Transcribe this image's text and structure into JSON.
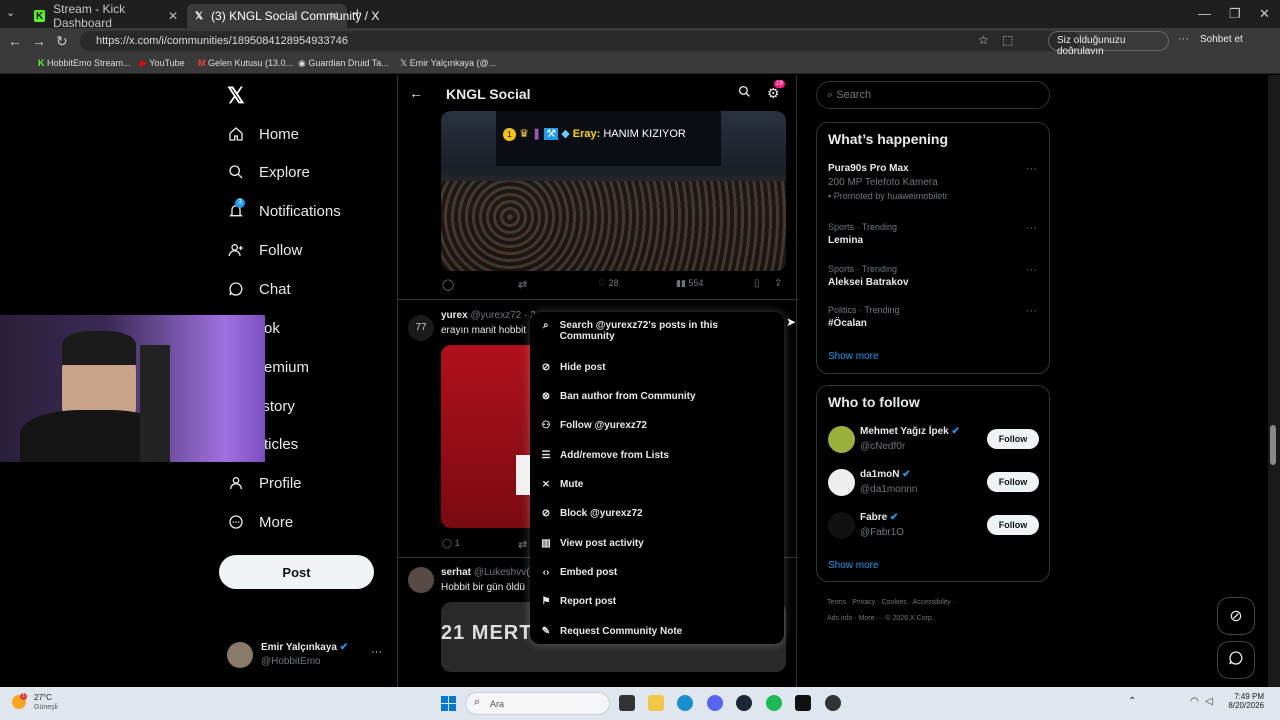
{
  "browser": {
    "tabs": [
      {
        "title": "Stream - Kick Dashboard",
        "active": false
      },
      {
        "title": "(3) KNGL Social Community / X",
        "active": true
      }
    ],
    "url": "https://x.com/i/communities/1895084128954933746",
    "verify_label": "Siz olduğunuzu doğrulayın",
    "chat_label": "Sohbet et",
    "bookmarks": [
      "HobbitEmo Stream...",
      "YouTube",
      "Gelen Kutusu (13.0...",
      "Guardian Druid Ta...",
      "Emir Yalçınkaya (@..."
    ]
  },
  "nav": {
    "items": [
      {
        "label": "Home",
        "icon": "home-icon"
      },
      {
        "label": "Explore",
        "icon": "search-icon"
      },
      {
        "label": "Notifications",
        "icon": "bell-icon",
        "badge": "3"
      },
      {
        "label": "Follow",
        "icon": "add-person-icon"
      },
      {
        "label": "Chat",
        "icon": "chat-icon"
      },
      {
        "label": "rok",
        "icon": "grok-icon"
      },
      {
        "label": "remium",
        "icon": "premium-icon"
      },
      {
        "label": "istory",
        "icon": "history-icon"
      },
      {
        "label": "rticles",
        "icon": "articles-icon"
      },
      {
        "label": "Profile",
        "icon": "person-icon"
      },
      {
        "label": "More",
        "icon": "more-circle-icon"
      }
    ],
    "post_label": "Post",
    "account": {
      "name": "Emir Yalçınkaya",
      "handle": "@HobbitEmo"
    }
  },
  "header": {
    "title": "KNGL Social",
    "settings_badge": "19"
  },
  "posts": [
    {
      "image_caption": "Eray: HANIM KIZIYOR",
      "caption_name": "Eray:",
      "caption_text": "HANIM KIZIYOR",
      "likes": "28",
      "views": "554"
    },
    {
      "name": "yurex",
      "handle": "@yurexz72 · 2",
      "text": "erayın manit hobbit",
      "replies": "1"
    },
    {
      "name": "serhat",
      "handle": "@Lukeshvv(",
      "text": "Hobbit bir gün öldü",
      "image_text": "21 MERT"
    }
  ],
  "context_menu": [
    {
      "label": "Search @yurexz72's posts in this Community",
      "icon": "search-icon"
    },
    {
      "label": "Hide post",
      "icon": "eye-off-icon"
    },
    {
      "label": "Ban author from Community",
      "icon": "ban-icon"
    },
    {
      "label": "Follow @yurexz72",
      "icon": "add-person-icon"
    },
    {
      "label": "Add/remove from Lists",
      "icon": "list-icon"
    },
    {
      "label": "Mute",
      "icon": "mute-icon"
    },
    {
      "label": "Block @yurexz72",
      "icon": "block-icon"
    },
    {
      "label": "View post activity",
      "icon": "analytics-icon"
    },
    {
      "label": "Embed post",
      "icon": "code-icon"
    },
    {
      "label": "Report post",
      "icon": "flag-icon"
    },
    {
      "label": "Request Community Note",
      "icon": "note-icon"
    }
  ],
  "right": {
    "search_placeholder": "Search",
    "whats_happening": {
      "title": "What’s happening",
      "promo": {
        "title": "Pura90s Pro Max",
        "subtitle": "200 MP Telefoto Kamera",
        "promoted": "Promoted by huaweimobiletr"
      },
      "trends": [
        {
          "meta": "Sports · Trending",
          "name": "Lemina"
        },
        {
          "meta": "Sports · Trending",
          "name": "Aleksei Batrakov"
        },
        {
          "meta": "Politics · Trending",
          "name": "#Öcalan"
        }
      ],
      "show_more": "Show more"
    },
    "who_to_follow": {
      "title": "Who to follow",
      "users": [
        {
          "name": "Mehmet Yağız İpek",
          "handle": "@cNedf0r",
          "button": "Follow"
        },
        {
          "name": "da1moN",
          "handle": "@da1monnn",
          "button": "Follow"
        },
        {
          "name": "Fabre",
          "handle": "@Fabr1O",
          "button": "Follow"
        }
      ],
      "show_more": "Show more"
    },
    "footer": [
      "Terms",
      "Privacy",
      "Cookies",
      "Accessibility",
      "Ads info",
      "More ···",
      "© 2026 X Corp."
    ]
  },
  "taskbar": {
    "weather_temp": "27°C",
    "weather_desc": "Güneşli",
    "search_placeholder": "Ara",
    "time": "7:49 PM",
    "date": "8/20/2026"
  },
  "colors": {
    "accent": "#1d9bf0",
    "background": "#000000",
    "border": "#2f3336"
  }
}
